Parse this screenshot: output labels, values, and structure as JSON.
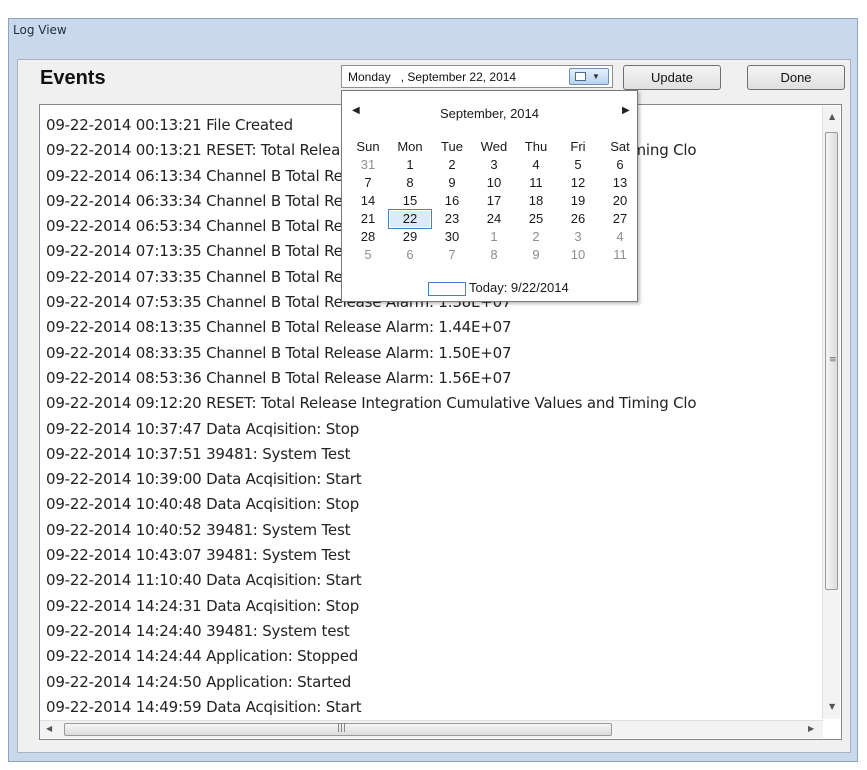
{
  "window": {
    "title": "Log View"
  },
  "header": {
    "events_label": "Events",
    "date_value": "Monday   , September 22, 2014",
    "update_label": "Update",
    "done_label": "Done"
  },
  "calendar": {
    "month_label": "September, 2014",
    "day_names": [
      "Sun",
      "Mon",
      "Tue",
      "Wed",
      "Thu",
      "Fri",
      "Sat"
    ],
    "days": [
      {
        "d": "31",
        "other": true
      },
      {
        "d": "1"
      },
      {
        "d": "2"
      },
      {
        "d": "3"
      },
      {
        "d": "4"
      },
      {
        "d": "5"
      },
      {
        "d": "6"
      },
      {
        "d": "7"
      },
      {
        "d": "8"
      },
      {
        "d": "9"
      },
      {
        "d": "10"
      },
      {
        "d": "11"
      },
      {
        "d": "12"
      },
      {
        "d": "13"
      },
      {
        "d": "14"
      },
      {
        "d": "15"
      },
      {
        "d": "16"
      },
      {
        "d": "17"
      },
      {
        "d": "18"
      },
      {
        "d": "19"
      },
      {
        "d": "20"
      },
      {
        "d": "21"
      },
      {
        "d": "22",
        "selected": true
      },
      {
        "d": "23"
      },
      {
        "d": "24"
      },
      {
        "d": "25"
      },
      {
        "d": "26"
      },
      {
        "d": "27"
      },
      {
        "d": "28"
      },
      {
        "d": "29"
      },
      {
        "d": "30"
      },
      {
        "d": "1",
        "other": true
      },
      {
        "d": "2",
        "other": true
      },
      {
        "d": "3",
        "other": true
      },
      {
        "d": "4",
        "other": true
      },
      {
        "d": "5",
        "other": true
      },
      {
        "d": "6",
        "other": true
      },
      {
        "d": "7",
        "other": true
      },
      {
        "d": "8",
        "other": true
      },
      {
        "d": "9",
        "other": true
      },
      {
        "d": "10",
        "other": true
      },
      {
        "d": "11",
        "other": true
      }
    ],
    "today_label": "Today: 9/22/2014"
  },
  "log": {
    "lines": [
      "09-22-2014 00:13:21 File Created",
      "09-22-2014 00:13:21 RESET: Total Release Integration Cumulative Values and Timing Clo",
      "09-22-2014 06:13:34 Channel B Total Release Alarm: 1.20E+07",
      "09-22-2014 06:33:34 Channel B Total Release Alarm: 1.26E+07",
      "09-22-2014 06:53:34 Channel B Total Release Alarm: 1.32E+07",
      "09-22-2014 07:13:35 Channel B Total Release Alarm: 1.38E+07",
      "09-22-2014 07:33:35 Channel B Total Release Alarm: 1.38E+07",
      "09-22-2014 07:53:35 Channel B Total Release Alarm: 1.38E+07",
      "09-22-2014 08:13:35 Channel B Total Release Alarm: 1.44E+07",
      "09-22-2014 08:33:35 Channel B Total Release Alarm: 1.50E+07",
      "09-22-2014 08:53:36 Channel B Total Release Alarm: 1.56E+07",
      "09-22-2014 09:12:20 RESET: Total Release Integration Cumulative Values and Timing Clo",
      "09-22-2014 10:37:47 Data Acqisition: Stop",
      "09-22-2014 10:37:51 39481: System Test",
      "09-22-2014 10:39:00 Data Acqisition: Start",
      "09-22-2014 10:40:48 Data Acqisition: Stop",
      "09-22-2014 10:40:52 39481: System Test",
      "09-22-2014 10:43:07 39481: System Test",
      "09-22-2014 11:10:40 Data Acqisition: Start",
      "09-22-2014 14:24:31 Data Acqisition: Stop",
      "09-22-2014 14:24:40 39481: System test",
      "09-22-2014 14:24:44 Application: Stopped",
      "09-22-2014 14:24:50 Application: Started",
      "09-22-2014 14:49:59 Data Acqisition: Start"
    ]
  }
}
